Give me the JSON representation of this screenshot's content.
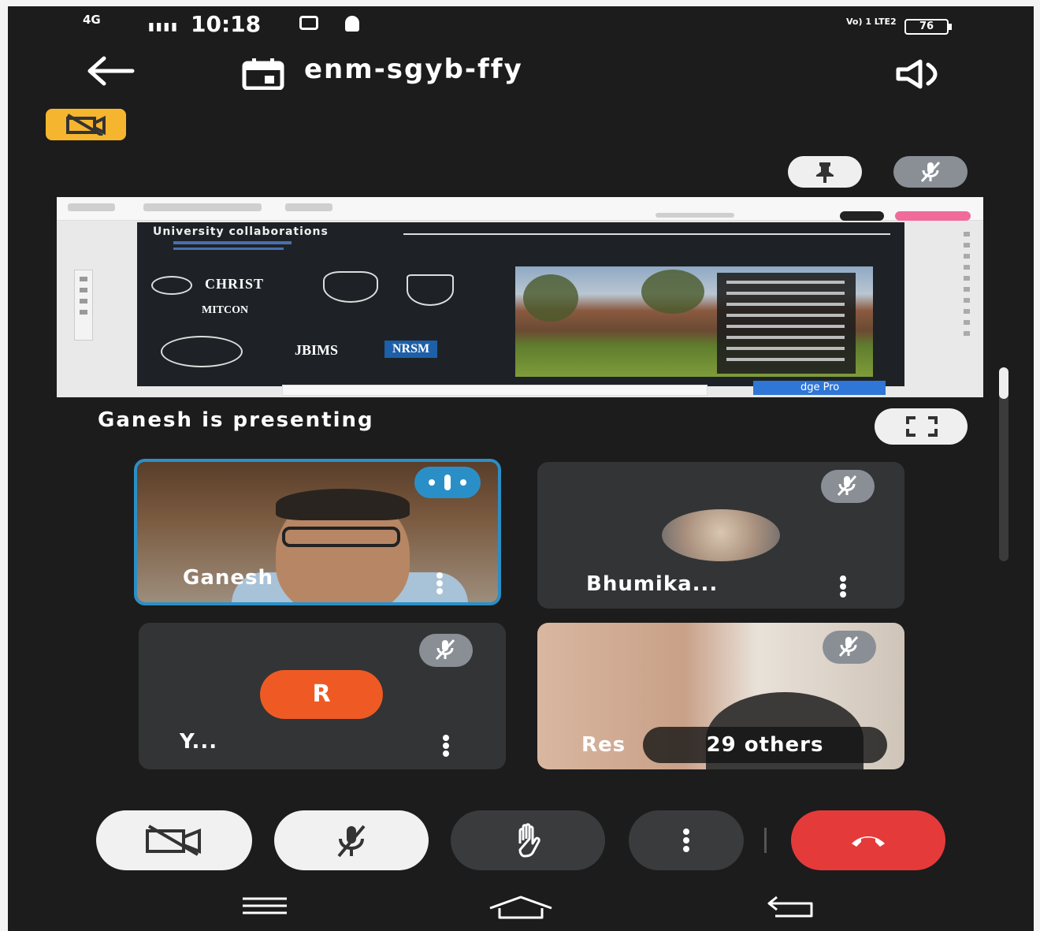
{
  "status_bar": {
    "network": "4G",
    "time": "10:18",
    "lte": "Vo) 1 LTE2",
    "battery": "76"
  },
  "header": {
    "meeting_code": "enm-sgyb-ffy"
  },
  "shared_screen": {
    "slide_title": "University collaborations",
    "logos": [
      "CHRIST",
      "MITCON",
      "JBIMS",
      "NRSM"
    ],
    "edge_banner": "dge Pro"
  },
  "presenting_text": "Ganesh  is presenting",
  "tiles": [
    {
      "name": "Ganesh"
    },
    {
      "name": "Bhumika..."
    },
    {
      "name": "Y...",
      "avatar_letter": "R"
    },
    {
      "name": "Res",
      "others": "29 others"
    }
  ],
  "colors": {
    "accent_blue": "#2b8fc7",
    "end_call_red": "#e53a3a",
    "badge_yellow": "#f6b52f",
    "avatar_orange": "#ef5a24"
  }
}
